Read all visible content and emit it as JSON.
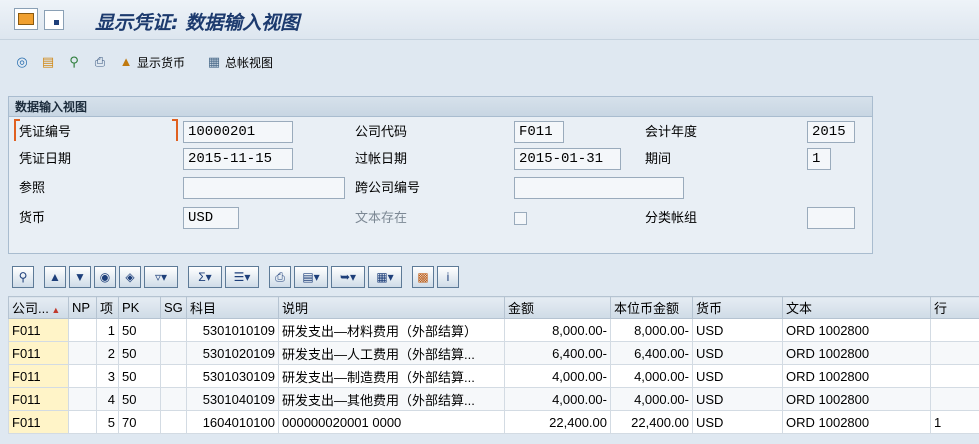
{
  "window": {
    "title": "显示凭证: 数据输入视图"
  },
  "toolbar": {
    "items": [
      {
        "name": "glasses-icon",
        "glyph": "👓"
      },
      {
        "name": "copy-icon",
        "glyph": "📋"
      },
      {
        "name": "display-doc-icon",
        "glyph": "🔍"
      },
      {
        "name": "print-icon",
        "glyph": "🖨"
      }
    ],
    "currency_label": "显示货币",
    "ledger_label": "总帐视图"
  },
  "header_group": {
    "title": "数据输入视图",
    "labels": {
      "doc_no": "凭证编号",
      "company": "公司代码",
      "fiscal_year": "会计年度",
      "doc_date": "凭证日期",
      "posting_date": "过帐日期",
      "period": "期间",
      "reference": "参照",
      "cross_company": "跨公司编号",
      "currency": "货币",
      "text_exists": "文本存在",
      "ledger_group": "分类帐组"
    },
    "values": {
      "doc_no": "10000201",
      "company": "F011",
      "fiscal_year": "2015",
      "doc_date": "2015-11-15",
      "posting_date": "2015-01-31",
      "period": "1",
      "reference": "",
      "cross_company": "",
      "currency": "USD",
      "ledger_group": ""
    }
  },
  "alv_toolbar": {
    "buttons": [
      "details-icon",
      "sort-asc-icon",
      "sort-desc-icon",
      "find-icon",
      "find-next-icon",
      "filter-icon",
      "sum-icon",
      "subtotal-icon",
      "print-preview-icon",
      "views-icon",
      "export-icon",
      "layout-icon",
      "graphic-icon",
      "info-icon"
    ]
  },
  "table": {
    "headers": [
      "公司...",
      "NP",
      "项",
      "PK",
      "SG",
      "科目",
      "说明",
      "金额",
      "本位币金额",
      "货币",
      "文本",
      "行"
    ],
    "rows": [
      [
        "F011",
        "",
        "1",
        "50",
        "",
        "5301010109",
        "研发支出—材料费用（外部结算）",
        "8,000.00-",
        "8,000.00-",
        "USD",
        "ORD 1002800",
        ""
      ],
      [
        "F011",
        "",
        "2",
        "50",
        "",
        "5301020109",
        "研发支出—人工费用（外部结算...",
        "6,400.00-",
        "6,400.00-",
        "USD",
        "ORD 1002800",
        ""
      ],
      [
        "F011",
        "",
        "3",
        "50",
        "",
        "5301030109",
        "研发支出—制造费用（外部结算...",
        "4,000.00-",
        "4,000.00-",
        "USD",
        "ORD 1002800",
        ""
      ],
      [
        "F011",
        "",
        "4",
        "50",
        "",
        "5301040109",
        "研发支出—其他费用（外部结算...",
        "4,000.00-",
        "4,000.00-",
        "USD",
        "ORD 1002800",
        ""
      ],
      [
        "F011",
        "",
        "5",
        "70",
        "",
        "1604010100",
        "000000020001 0000",
        "22,400.00",
        "22,400.00",
        "USD",
        "ORD 1002800",
        "1"
      ]
    ]
  }
}
